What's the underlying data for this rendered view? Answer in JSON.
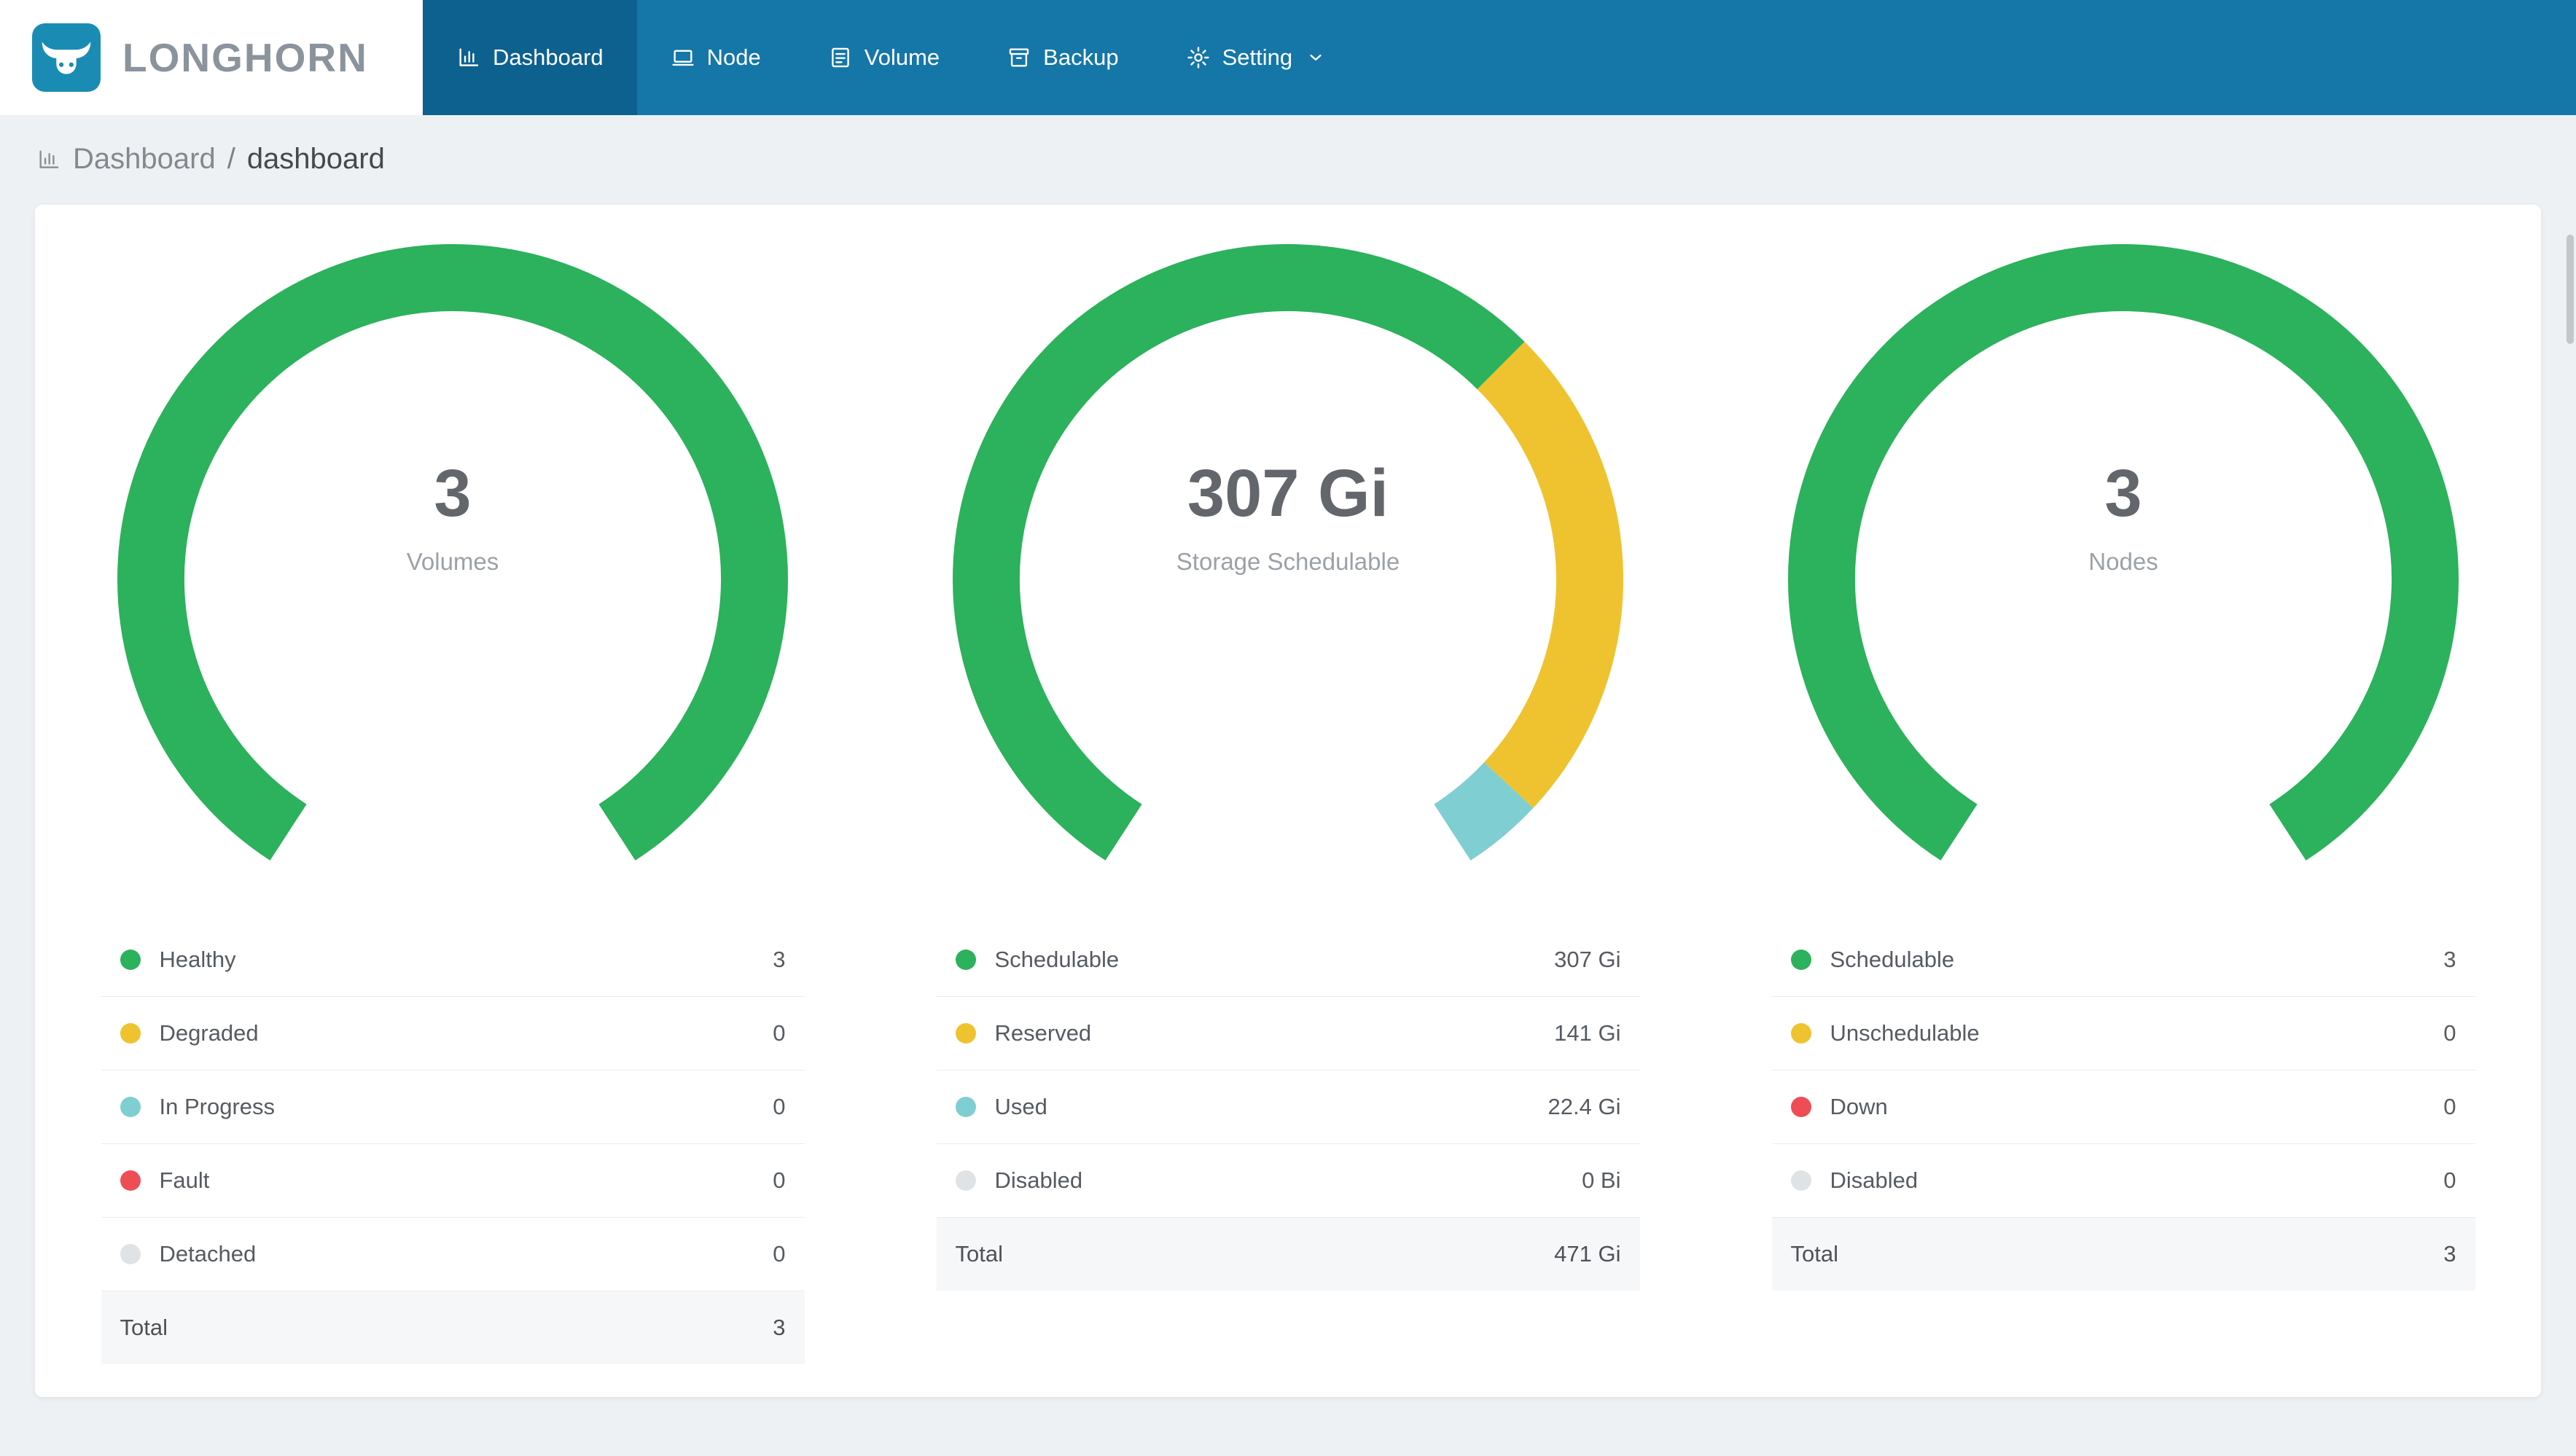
{
  "navbar": {
    "brand": "LONGHORN",
    "items": [
      {
        "label": "Dashboard",
        "icon": "dashboard-icon",
        "active": true
      },
      {
        "label": "Node",
        "icon": "node-icon",
        "active": false
      },
      {
        "label": "Volume",
        "icon": "volume-icon",
        "active": false
      },
      {
        "label": "Backup",
        "icon": "backup-icon",
        "active": false
      },
      {
        "label": "Setting",
        "icon": "setting-icon",
        "active": false,
        "has_dropdown": true
      }
    ]
  },
  "breadcrumb": {
    "section": "Dashboard",
    "separator": "/",
    "page": "dashboard"
  },
  "colors": {
    "navbar": "#1576a8",
    "navbar_active": "#0d618f",
    "healthy_green": "#2cb15c",
    "warning_yellow": "#efc32f",
    "progress_teal": "#7fced2",
    "fault_red": "#ee4d55",
    "disabled_gray": "#e0e3e6"
  },
  "chart_data": [
    {
      "type": "gauge",
      "title": "3",
      "subtitle": "Volumes",
      "segments": [
        {
          "label": "Healthy",
          "value": 3,
          "display": "3",
          "color": "#2cb15c"
        },
        {
          "label": "Degraded",
          "value": 0,
          "display": "0",
          "color": "#efc32f"
        },
        {
          "label": "In Progress",
          "value": 0,
          "display": "0",
          "color": "#7fced2"
        },
        {
          "label": "Fault",
          "value": 0,
          "display": "0",
          "color": "#ee4d55"
        },
        {
          "label": "Detached",
          "value": 0,
          "display": "0",
          "color": "#e0e3e6"
        }
      ],
      "total": {
        "label": "Total",
        "display": "3"
      }
    },
    {
      "type": "gauge",
      "title": "307 Gi",
      "subtitle": "Storage Schedulable",
      "segments": [
        {
          "label": "Schedulable",
          "value": 307,
          "display": "307 Gi",
          "color": "#2cb15c"
        },
        {
          "label": "Reserved",
          "value": 141,
          "display": "141 Gi",
          "color": "#efc32f"
        },
        {
          "label": "Used",
          "value": 22.4,
          "display": "22.4 Gi",
          "color": "#7fced2"
        },
        {
          "label": "Disabled",
          "value": 0,
          "display": "0 Bi",
          "color": "#e0e3e6"
        }
      ],
      "total": {
        "label": "Total",
        "display": "471 Gi"
      }
    },
    {
      "type": "gauge",
      "title": "3",
      "subtitle": "Nodes",
      "segments": [
        {
          "label": "Schedulable",
          "value": 3,
          "display": "3",
          "color": "#2cb15c"
        },
        {
          "label": "Unschedulable",
          "value": 0,
          "display": "0",
          "color": "#efc32f"
        },
        {
          "label": "Down",
          "value": 0,
          "display": "0",
          "color": "#ee4d55"
        },
        {
          "label": "Disabled",
          "value": 0,
          "display": "0",
          "color": "#e0e3e6"
        }
      ],
      "total": {
        "label": "Total",
        "display": "3"
      }
    }
  ]
}
